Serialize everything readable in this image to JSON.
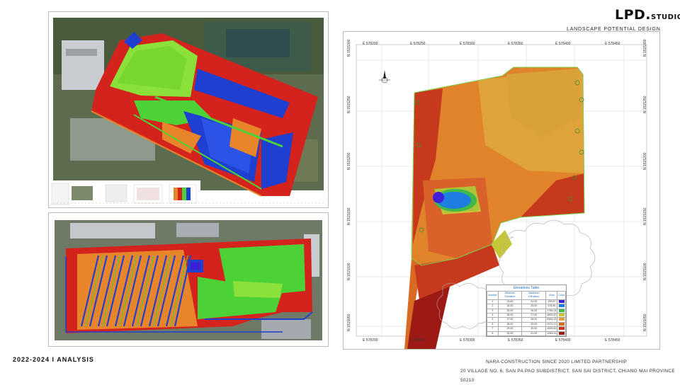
{
  "brand": {
    "name": "LPD.",
    "suffix": "STUDIO",
    "tagline": "LANDSCAPE POTENTIAL DESIGN STUDIO"
  },
  "footer": {
    "left": "2022-2024 I ANALYSIS",
    "company": "NARA CONSTRUCTION SINCE 2020 LIMITED PARTNERSHIP",
    "address": "20 VILLAGE NO. 6, SAN PA PAO SUBDISTRICT, SAN SAI DISTRICT, CHIANG MAI PROVINCE 50210"
  },
  "right_map": {
    "top_coords": [
      "E 578200",
      "E 578250",
      "E 578300",
      "E 578350",
      "E 578400",
      "E 578450"
    ],
    "bottom_coords": [
      "E 578200",
      "E 578250",
      "E 578300",
      "E 578350",
      "E 578400",
      "E 578450"
    ],
    "left_coords": [
      "N 1515300",
      "N 1515250",
      "N 1515200",
      "N 1515150",
      "N 1515100",
      "N 1515050"
    ],
    "right_coords": [
      "N 1515300",
      "N 1515250",
      "N 1515200",
      "N 1515150",
      "N 1515100",
      "N 1515050"
    ],
    "table": {
      "title": "Elevations Table",
      "headers": [
        "Number",
        "Minimum Elevation",
        "Maximum Elevation",
        "Area",
        "Color"
      ],
      "rows": [
        [
          "1",
          "23.60",
          "24.00",
          "159.87",
          "#3c1fd6"
        ],
        [
          "2",
          "24.00",
          "25.00",
          "978.56",
          "#1e7de0"
        ],
        [
          "3",
          "25.00",
          "26.00",
          "1785.24",
          "#3fb94a"
        ],
        [
          "4",
          "26.00",
          "27.00",
          "4893.52",
          "#c6c63a"
        ],
        [
          "5",
          "27.00",
          "28.00",
          "8364.43",
          "#e0a23a"
        ],
        [
          "6",
          "28.00",
          "29.00",
          "9371.37",
          "#d86a24"
        ],
        [
          "7",
          "29.00",
          "30.00",
          "2839.62",
          "#c7391d"
        ],
        [
          "8",
          "30.00",
          "31.00",
          "1054.91",
          "#9d1a14"
        ]
      ]
    }
  },
  "colors": {
    "blue": "#1f3fd0",
    "green": "#4cd137",
    "lime": "#8be03a",
    "orange": "#e8852a",
    "red": "#d3231c",
    "darkred": "#9d1a14",
    "yellow": "#d9c23a",
    "aerial": "#5d6b4f"
  }
}
